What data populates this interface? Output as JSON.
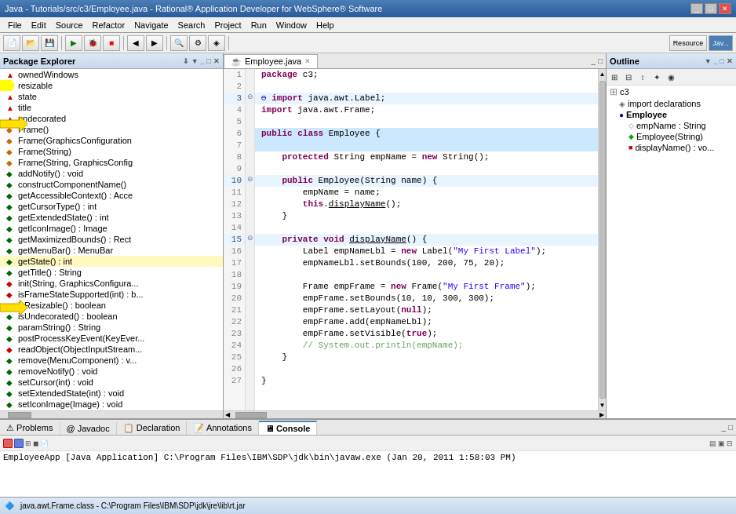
{
  "window": {
    "title": "Java - Tutorials/src/c3/Employee.java - Rational® Application Developer for WebSphere® Software",
    "controls": [
      "_",
      "□",
      "✕"
    ]
  },
  "menu": {
    "items": [
      "File",
      "Edit",
      "Source",
      "Refactor",
      "Navigate",
      "Search",
      "Project",
      "Run",
      "Window",
      "Help"
    ]
  },
  "leftPanel": {
    "title": "Package Explorer",
    "treeItems": [
      {
        "label": "ownedWindows",
        "icon": "▲",
        "iconColor": "red",
        "indent": 1
      },
      {
        "label": "resizable",
        "icon": "▲",
        "iconColor": "red",
        "indent": 1,
        "hasArrow": true
      },
      {
        "label": "state",
        "icon": "▲",
        "iconColor": "red",
        "indent": 1
      },
      {
        "label": "title",
        "icon": "▲",
        "iconColor": "red",
        "indent": 1
      },
      {
        "label": "undecorated",
        "icon": "▲",
        "iconColor": "red",
        "indent": 1
      },
      {
        "label": "Frame()",
        "icon": "◆",
        "iconColor": "orange",
        "indent": 1
      },
      {
        "label": "Frame(GraphicsConfiguration)",
        "icon": "◆",
        "iconColor": "orange",
        "indent": 1
      },
      {
        "label": "Frame(String)",
        "icon": "◆",
        "iconColor": "orange",
        "indent": 1
      },
      {
        "label": "Frame(String, GraphicsConfig...)",
        "icon": "◆",
        "iconColor": "orange",
        "indent": 1
      },
      {
        "label": "addNotify() : void",
        "icon": "◆",
        "iconColor": "green",
        "indent": 1
      },
      {
        "label": "constructComponentName()",
        "icon": "◆",
        "iconColor": "green",
        "indent": 1
      },
      {
        "label": "getAccessibleContext() : Acce",
        "icon": "◆",
        "iconColor": "green",
        "indent": 1
      },
      {
        "label": "getCursorType() : int",
        "icon": "◆",
        "iconColor": "green",
        "indent": 1
      },
      {
        "label": "getExtendedState() : int",
        "icon": "◆",
        "iconColor": "green",
        "indent": 1
      },
      {
        "label": "getIconImage() : Image",
        "icon": "◆",
        "iconColor": "green",
        "indent": 1
      },
      {
        "label": "getMaximizedBounds() : Rect",
        "icon": "◆",
        "iconColor": "green",
        "indent": 1
      },
      {
        "label": "getMenuBar() : MenuBar",
        "icon": "◆",
        "iconColor": "green",
        "indent": 1
      },
      {
        "label": "getState() : int",
        "icon": "◆",
        "iconColor": "green",
        "indent": 1,
        "hasArrow": true
      },
      {
        "label": "getTitle() : String",
        "icon": "◆",
        "iconColor": "green",
        "indent": 1
      },
      {
        "label": "init(String, GraphicsConfigura...",
        "icon": "◆",
        "iconColor": "red",
        "indent": 1
      },
      {
        "label": "isFrameStateSupported(int) : b...",
        "icon": "◆",
        "iconColor": "red",
        "indent": 1
      },
      {
        "label": "isResizable() : boolean",
        "icon": "◆",
        "iconColor": "green",
        "indent": 1
      },
      {
        "label": "isUndecorated() : boolean",
        "icon": "◆",
        "iconColor": "green",
        "indent": 1
      },
      {
        "label": "paramString() : String",
        "icon": "◆",
        "iconColor": "green",
        "indent": 1
      },
      {
        "label": "postProcessKeyEvent(KeyEven...",
        "icon": "◆",
        "iconColor": "green",
        "indent": 1
      },
      {
        "label": "readObject(ObjectInputStream...)",
        "icon": "◆",
        "iconColor": "red",
        "indent": 1
      },
      {
        "label": "remove(MenuComponent) : v...",
        "icon": "◆",
        "iconColor": "green",
        "indent": 1
      },
      {
        "label": "removeNotify() : void",
        "icon": "◆",
        "iconColor": "green",
        "indent": 1
      },
      {
        "label": "setCursor(int) : void",
        "icon": "◆",
        "iconColor": "green",
        "indent": 1
      },
      {
        "label": "setExtendedState(int) : void",
        "icon": "◆",
        "iconColor": "green",
        "indent": 1
      },
      {
        "label": "setIconImage(Image) : void",
        "icon": "◆",
        "iconColor": "green",
        "indent": 1
      }
    ]
  },
  "editor": {
    "tab": "Employee.java",
    "lines": [
      {
        "num": 1,
        "text": "package c3;",
        "fold": false
      },
      {
        "num": 2,
        "text": "",
        "fold": false
      },
      {
        "num": 3,
        "text": "import java.awt.Label;",
        "fold": true
      },
      {
        "num": 4,
        "text": "import java.awt.Frame;",
        "fold": false
      },
      {
        "num": 5,
        "text": "",
        "fold": false
      },
      {
        "num": 6,
        "text": "public class Employee {",
        "fold": false,
        "highlighted": true
      },
      {
        "num": 7,
        "text": "",
        "fold": false,
        "highlighted": true
      },
      {
        "num": 8,
        "text": "    protected String empName = new String();",
        "fold": false
      },
      {
        "num": 9,
        "text": "",
        "fold": false
      },
      {
        "num": 10,
        "text": "    public Employee(String name) {",
        "fold": true
      },
      {
        "num": 11,
        "text": "        empName = name;",
        "fold": false
      },
      {
        "num": 12,
        "text": "        this.displayName();",
        "fold": false
      },
      {
        "num": 13,
        "text": "    }",
        "fold": false
      },
      {
        "num": 14,
        "text": "",
        "fold": false
      },
      {
        "num": 15,
        "text": "    private void displayName() {",
        "fold": true
      },
      {
        "num": 16,
        "text": "        Label empNameLbl = new Label(\"My First Label\");",
        "fold": false
      },
      {
        "num": 17,
        "text": "        empNameLbl.setBounds(100, 200, 75, 20);",
        "fold": false
      },
      {
        "num": 18,
        "text": "",
        "fold": false
      },
      {
        "num": 19,
        "text": "        Frame empFrame = new Frame(\"My First Frame\");",
        "fold": false
      },
      {
        "num": 20,
        "text": "        empFrame.setBounds(10, 10, 300, 300);",
        "fold": false
      },
      {
        "num": 21,
        "text": "        empFrame.setLayout(null);",
        "fold": false
      },
      {
        "num": 22,
        "text": "        empFrame.add(empNameLbl);",
        "fold": false
      },
      {
        "num": 23,
        "text": "        empFrame.setVisible(true);",
        "fold": false
      },
      {
        "num": 24,
        "text": "        // System.out.println(empName);",
        "fold": false
      },
      {
        "num": 25,
        "text": "    }",
        "fold": false
      },
      {
        "num": 26,
        "text": "",
        "fold": false
      },
      {
        "num": 27,
        "text": "}",
        "fold": false
      }
    ]
  },
  "outline": {
    "title": "Outline",
    "items": [
      {
        "label": "c3",
        "icon": "pkg",
        "indent": 0
      },
      {
        "label": "import declarations",
        "icon": "imports",
        "indent": 1
      },
      {
        "label": "Employee",
        "icon": "class",
        "indent": 1
      },
      {
        "label": "empName : String",
        "icon": "field",
        "indent": 2
      },
      {
        "label": "Employee(String)",
        "icon": "constructor",
        "indent": 2
      },
      {
        "label": "displayName() : vo...",
        "icon": "method",
        "indent": 2
      }
    ]
  },
  "bottomPanel": {
    "tabs": [
      "Problems",
      "Javadoc",
      "Declaration",
      "Annotations",
      "Console"
    ],
    "activeTab": "Console",
    "consoleText": "EmployeeApp [Java Application] C:\\Program Files\\IBM\\SDP\\jdk\\bin\\javaw.exe (Jan 20, 2011 1:58:03 PM)"
  },
  "statusBar": {
    "icon": "🔷",
    "text": "java.awt.Frame.class - C:\\Program Files\\IBM\\SDP\\jdk\\jre\\lib\\rt.jar"
  }
}
